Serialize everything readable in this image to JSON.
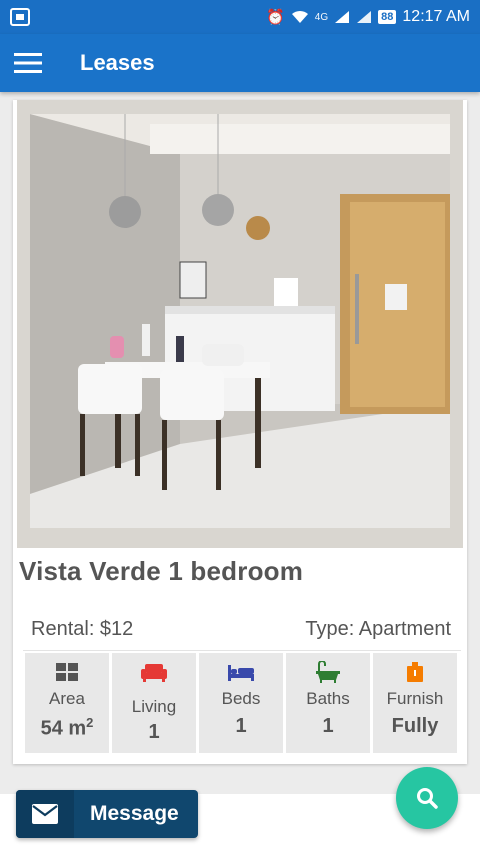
{
  "status_bar": {
    "battery": "88",
    "time": "12:17 AM",
    "network": "4G"
  },
  "app_bar": {
    "title": "Leases"
  },
  "listing": {
    "title": "Vista Verde 1 bedroom",
    "rental": "Rental: $12",
    "type": "Type: Apartment",
    "features": [
      {
        "label": "Area",
        "value": "54 m",
        "unit_sup": "2",
        "icon": "grid-icon",
        "color": "#555555"
      },
      {
        "label": "Living",
        "value": "1",
        "icon": "sofa-icon",
        "color": "#e53935"
      },
      {
        "label": "Beds",
        "value": "1",
        "icon": "bed-icon",
        "color": "#3949ab"
      },
      {
        "label": "Baths",
        "value": "1",
        "icon": "bathtub-icon",
        "color": "#2e7d32"
      },
      {
        "label": "Furnish",
        "value": "Fully",
        "icon": "furniture-icon",
        "color": "#f57c00"
      }
    ]
  },
  "actions": {
    "message_label": "Message"
  },
  "colors": {
    "primary": "#1a73c9",
    "message_button": "#10476e",
    "fab": "#26c6a2"
  }
}
